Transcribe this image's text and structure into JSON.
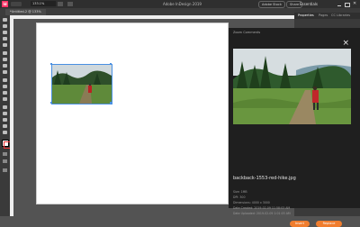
{
  "app": {
    "icon_text": "Id",
    "window_title": "Adobe InDesign 2019",
    "zoom": "133.1%",
    "document_tab": "*Untitled-2 @ 133%",
    "search_button": "Adobe Stock",
    "share_button": "Share",
    "workspace": "Essentials"
  },
  "dock": {
    "tabs": [
      "Properties",
      "Pages",
      "CC Libraries"
    ]
  },
  "panel": {
    "header": "Zoom Comments",
    "filename": "backback-1553-red-hike.jpg",
    "meta": [
      "Size: 1MB",
      "DPI: 300",
      "Dimensions: 4000 x 3000",
      "Date Created: 2019-02-09 11:58:03 AM",
      "Date Uploaded: 2019-02-09 1:01:03 AM"
    ],
    "buttons": {
      "left": "Insert",
      "right": "Replace"
    }
  },
  "colors": {
    "accent": "#f07d2e",
    "brand": "#ff3366",
    "selection": "#4a90e2"
  }
}
